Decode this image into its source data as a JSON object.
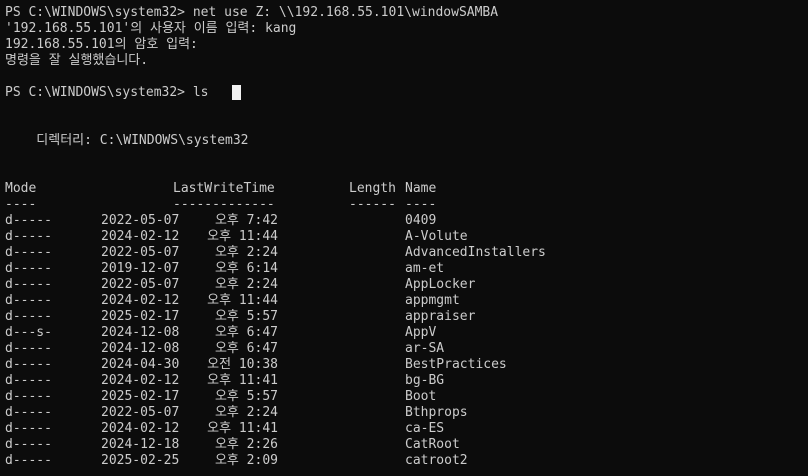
{
  "colors": {
    "background": "#0c0c0c",
    "text": "#cccccc",
    "cursor": "#f2f2f2"
  },
  "terminal": {
    "cmd1": "PS C:\\WINDOWS\\system32> net use Z: \\\\192.168.55.101\\windowSAMBA",
    "user_prompt": "'192.168.55.101'의 사용자 이름 입력: kang",
    "pass_prompt": "192.168.55.101의 암호 입력:",
    "success_msg": "명령을 잘 실행했습니다.",
    "prompt2": "PS C:\\WINDOWS\\system32> ls",
    "directory_line": "    디렉터리: C:\\WINDOWS\\system32",
    "header_mode": "Mode",
    "header_lwt": "LastWriteTime",
    "header_length": "Length",
    "header_name": "Name",
    "sep_mode": "----",
    "sep_lwt": "-------------",
    "sep_length": "------",
    "sep_name": "----"
  },
  "rows": [
    {
      "mode": "d-----",
      "date": "2022-05-07",
      "time": "오후 7:42",
      "length": "",
      "name": "0409"
    },
    {
      "mode": "d-----",
      "date": "2024-02-12",
      "time": "오후 11:44",
      "length": "",
      "name": "A-Volute"
    },
    {
      "mode": "d-----",
      "date": "2022-05-07",
      "time": "오후 2:24",
      "length": "",
      "name": "AdvancedInstallers"
    },
    {
      "mode": "d-----",
      "date": "2019-12-07",
      "time": "오후 6:14",
      "length": "",
      "name": "am-et"
    },
    {
      "mode": "d-----",
      "date": "2022-05-07",
      "time": "오후 2:24",
      "length": "",
      "name": "AppLocker"
    },
    {
      "mode": "d-----",
      "date": "2024-02-12",
      "time": "오후 11:44",
      "length": "",
      "name": "appmgmt"
    },
    {
      "mode": "d-----",
      "date": "2025-02-17",
      "time": "오후 5:57",
      "length": "",
      "name": "appraiser"
    },
    {
      "mode": "d---s-",
      "date": "2024-12-08",
      "time": "오후 6:47",
      "length": "",
      "name": "AppV"
    },
    {
      "mode": "d-----",
      "date": "2024-12-08",
      "time": "오후 6:47",
      "length": "",
      "name": "ar-SA"
    },
    {
      "mode": "d-----",
      "date": "2024-04-30",
      "time": "오전 10:38",
      "length": "",
      "name": "BestPractices"
    },
    {
      "mode": "d-----",
      "date": "2024-02-12",
      "time": "오후 11:41",
      "length": "",
      "name": "bg-BG"
    },
    {
      "mode": "d-----",
      "date": "2025-02-17",
      "time": "오후 5:57",
      "length": "",
      "name": "Boot"
    },
    {
      "mode": "d-----",
      "date": "2022-05-07",
      "time": "오후 2:24",
      "length": "",
      "name": "Bthprops"
    },
    {
      "mode": "d-----",
      "date": "2024-02-12",
      "time": "오후 11:41",
      "length": "",
      "name": "ca-ES"
    },
    {
      "mode": "d-----",
      "date": "2024-12-18",
      "time": "오후 2:26",
      "length": "",
      "name": "CatRoot"
    },
    {
      "mode": "d-----",
      "date": "2025-02-25",
      "time": "오후 2:09",
      "length": "",
      "name": "catroot2"
    }
  ]
}
